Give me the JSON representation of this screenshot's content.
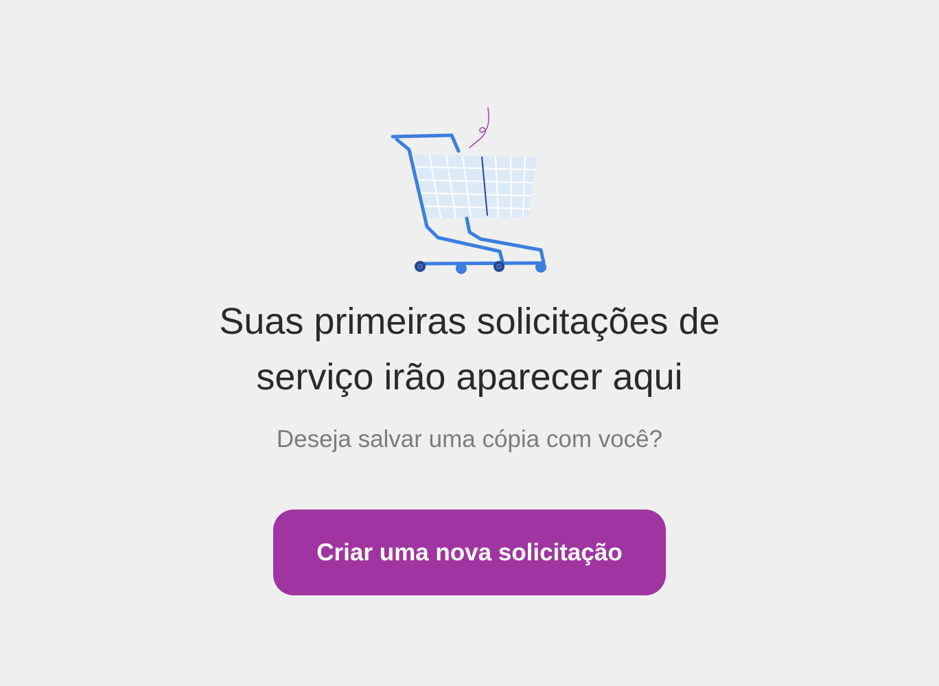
{
  "empty_state": {
    "illustration_icon": "shopping-cart-icon",
    "title_line1": "Suas primeiras solicitações de",
    "title_line2": "serviço irão aparecer aqui",
    "subtitle": "Deseja salvar uma cópia com você?",
    "cta_label": "Criar uma nova solicitação"
  },
  "colors": {
    "background": "#efefef",
    "title_text": "#2a2a2a",
    "subtitle_text": "#7b7b80",
    "cta_background": "#a034a0",
    "cta_text": "#ffffff",
    "cart_frame": "#3a7ee0",
    "cart_basket": "#dceaf8",
    "cart_wheel_dark": "#24478f",
    "ribbon": "#a34da8"
  }
}
